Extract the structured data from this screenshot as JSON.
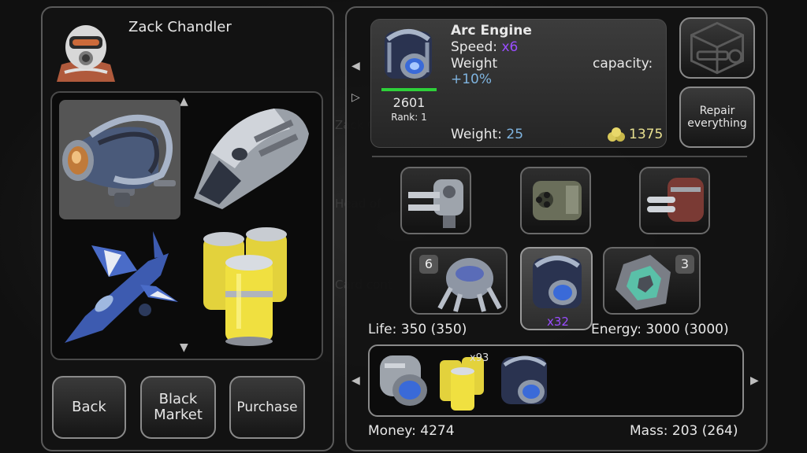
{
  "player": {
    "name": "Zack Chandler",
    "avatar_icon": "gas-mask-astronaut-icon"
  },
  "shop_items": [
    {
      "name": "Arc Engine",
      "icon": "arc-engine-icon",
      "selected": true
    },
    {
      "name": "Armored Hull Module",
      "icon": "hull-module-icon"
    },
    {
      "name": "Blue Fighter Ship",
      "icon": "fighter-ship-icon"
    },
    {
      "name": "Fuel Cells",
      "icon": "fuel-cells-icon"
    }
  ],
  "buttons": {
    "back": "Back",
    "black_market": "Black Market",
    "purchase": "Purchase"
  },
  "item_detail": {
    "name": "Arc Engine",
    "speed_label": "Speed:",
    "speed_value": "x6",
    "weight_label": "Weight",
    "weight_bonus": "+10%",
    "capacity_label": "capacity:",
    "score": "2601",
    "rank": "Rank: 1",
    "weight_text": "Weight:",
    "weight_value": "25",
    "price": "1375",
    "level_fraction": 1.0
  },
  "repair_button": "Repair everything",
  "equipped_modules": [
    {
      "icon": "twin-cannon-icon"
    },
    {
      "icon": "triple-cannon-icon"
    },
    {
      "icon": "rocket-launcher-icon"
    }
  ],
  "equipped_row2": [
    {
      "icon": "spider-drone-icon",
      "badge": "6"
    },
    {
      "icon": "arc-engine-icon",
      "multiplier": "x32",
      "selected": true
    },
    {
      "icon": "energy-crystal-icon",
      "badge": "3"
    }
  ],
  "stats": {
    "life": "Life: 350 (350)",
    "energy": "Energy: 3000 (3000)",
    "money": "Money: 4274",
    "mass": "Mass: 203 (264)"
  },
  "cargo": [
    {
      "icon": "thruster-pod-icon"
    },
    {
      "icon": "fuel-cells-icon",
      "count": "x93"
    },
    {
      "icon": "arc-engine-icon"
    }
  ],
  "colors": {
    "accent_purple": "#9a4dff",
    "accent_blue": "#7fb4e0",
    "level_bar_green": "#2ed13a",
    "gold": "#d9c95a"
  }
}
